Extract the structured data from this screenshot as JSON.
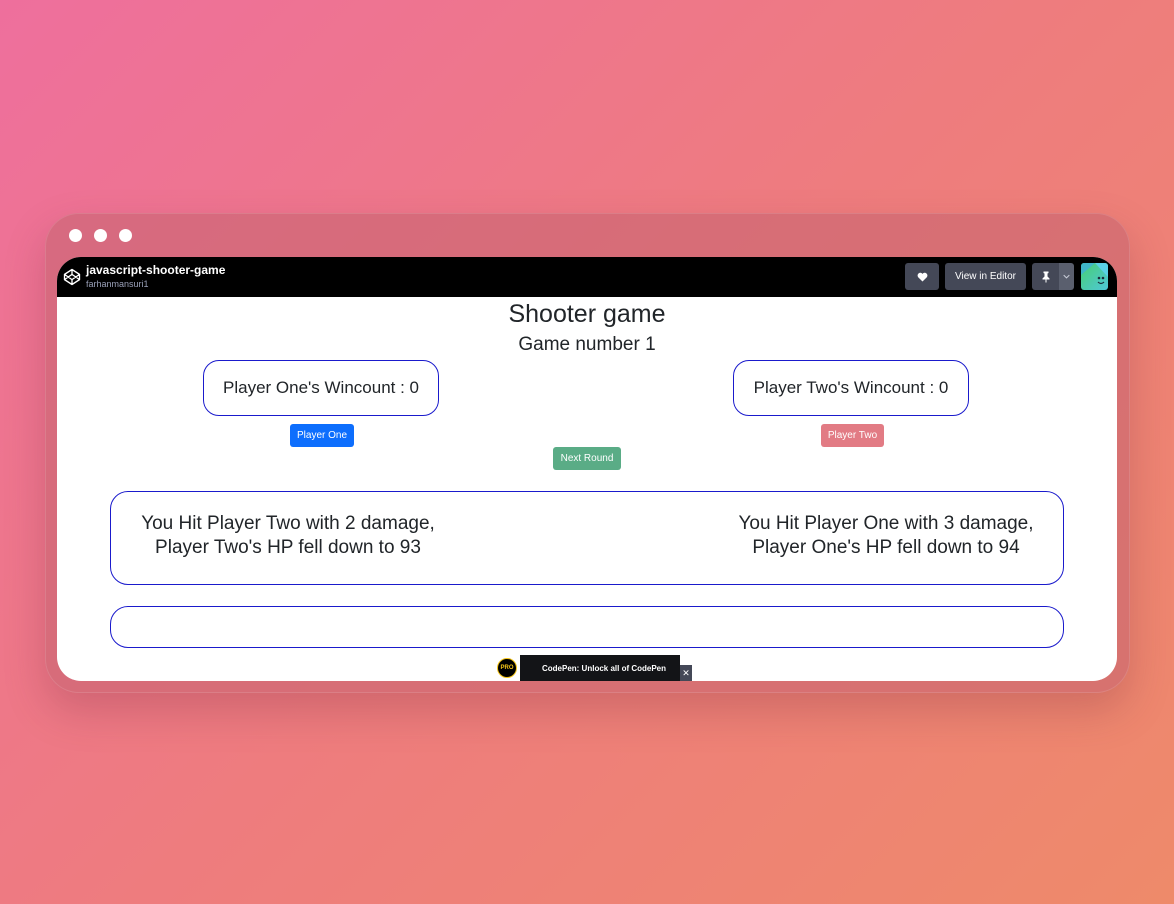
{
  "topbar": {
    "pen_title": "javascript-shooter-game",
    "author": "farhanmansuri1",
    "view_in_editor_label": "View in Editor"
  },
  "game": {
    "title": "Shooter game",
    "game_number": "Game number 1",
    "player_one_wincount": "Player One's Wincount : 0",
    "player_two_wincount": "Player Two's Wincount : 0",
    "player_one_button": "Player One",
    "player_two_button": "Player Two",
    "next_round_button": "Next Round",
    "log_left_line1": "You Hit Player Two with 2 damage,",
    "log_left_line2": "Player Two's HP fell down to 93",
    "log_right_line1": "You Hit Player One with 3 damage,",
    "log_right_line2": "Player One's HP fell down to 94"
  },
  "ad": {
    "badge": "PRO",
    "text": "CodePen: Unlock all of CodePen",
    "close": "✕"
  },
  "colors": {
    "player_one": "#0d6efd",
    "player_two": "#e27b84",
    "next_round": "#5aac86",
    "box_border": "#1a1acc"
  },
  "icons": {
    "logo": "codepen-logo-icon",
    "heart": "heart-icon",
    "pin": "pin-icon",
    "dropdown": "chevron-down-icon",
    "avatar": "avatar-icon"
  }
}
